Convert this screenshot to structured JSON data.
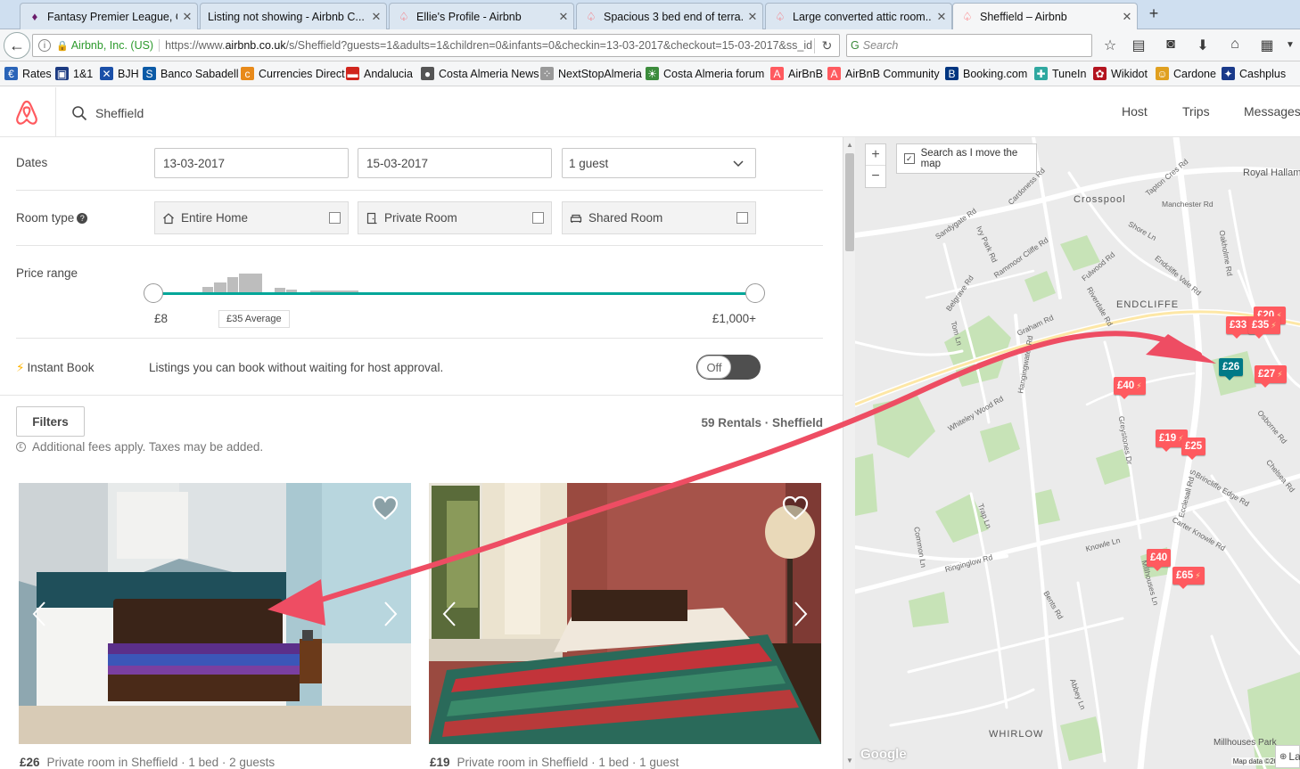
{
  "browser": {
    "tabs": [
      {
        "title": "Fantasy Premier League, O...",
        "icon": "fpl-icon"
      },
      {
        "title": "Listing not showing - Airbnb C...",
        "icon": "none"
      },
      {
        "title": "Ellie's Profile - Airbnb",
        "icon": "airbnb-icon"
      },
      {
        "title": "Spacious 3 bed end of terra...",
        "icon": "airbnb-icon"
      },
      {
        "title": "Large converted attic room...",
        "icon": "airbnb-icon"
      },
      {
        "title": "Sheffield – Airbnb",
        "icon": "airbnb-icon"
      }
    ],
    "new_tab": "+",
    "site_identity": "Airbnb, Inc. (US)",
    "url_prefix": "https://www.",
    "url_domain": "airbnb.co.uk",
    "url_rest": "/s/Sheffield?guests=1&adults=1&children=0&infants=0&checkin=13-03-2017&checkout=15-03-2017&ss_id",
    "search_placeholder": "Search",
    "bookmarks": [
      {
        "label": "Rates",
        "color": "#2a64b8",
        "glyph": "€"
      },
      {
        "label": "1&1",
        "color": "#1c3b82",
        "glyph": "▣"
      },
      {
        "label": "BJH",
        "color": "#1a4fa8",
        "glyph": "✕"
      },
      {
        "label": "Banco Sabadell",
        "color": "#0b5aa6",
        "glyph": "S"
      },
      {
        "label": "Currencies Direct",
        "color": "#e88a1a",
        "glyph": "c"
      },
      {
        "label": "Andalucia",
        "color": "#d0251d",
        "glyph": "▬"
      },
      {
        "label": "Costa Almeria News",
        "color": "#555555",
        "glyph": "●"
      },
      {
        "label": "NextStopAlmeria",
        "color": "#999999",
        "glyph": "⁘"
      },
      {
        "label": "Costa Almeria forum",
        "color": "#3c8c3c",
        "glyph": "☀"
      },
      {
        "label": "AirBnB",
        "color": "#ff5a5f",
        "glyph": "A"
      },
      {
        "label": "AirBnB Community",
        "color": "#ff5a5f",
        "glyph": "A"
      },
      {
        "label": "Booking.com",
        "color": "#003580",
        "glyph": "B"
      },
      {
        "label": "TuneIn",
        "color": "#2fa8a0",
        "glyph": "✚"
      },
      {
        "label": "Wikidot",
        "color": "#b3141f",
        "glyph": "✿"
      },
      {
        "label": "Cardone",
        "color": "#e0a020",
        "glyph": "☺"
      },
      {
        "label": "Cashplus",
        "color": "#1a3a8a",
        "glyph": "✦"
      }
    ]
  },
  "header": {
    "search_text": "Sheffield",
    "nav": [
      "Host",
      "Trips",
      "Messages"
    ],
    "brand_color": "#ff5a5f"
  },
  "filters": {
    "dates_label": "Dates",
    "checkin": "13-03-2017",
    "checkout": "15-03-2017",
    "guests": "1 guest",
    "room_type_label": "Room type",
    "help_glyph": "?",
    "room_types": [
      {
        "label": "Entire Home",
        "icon": "home-icon"
      },
      {
        "label": "Private Room",
        "icon": "door-icon"
      },
      {
        "label": "Shared Room",
        "icon": "couch-icon"
      }
    ],
    "price_label": "Price range",
    "price_min": "£8",
    "price_max": "£1,000+",
    "price_average": "£35 Average",
    "instant_book_label": "Instant Book",
    "instant_book_desc": "Listings you can book without waiting for host approval.",
    "instant_book_toggle": "Off",
    "filters_button": "Filters",
    "results_count": "59 Rentals · Sheffield",
    "fees_note": "Additional fees apply. Taxes may be added.",
    "accent_color": "#00a699"
  },
  "listings": [
    {
      "price": "£26",
      "title": "Private room in Sheffield",
      "details": "· 1 bed · 2 guests"
    },
    {
      "price": "£19",
      "title": "Private room in Sheffield",
      "details": "· 1 bed · 1 guest"
    }
  ],
  "map": {
    "search_as_move": "Search as I move the map",
    "zoom_in": "+",
    "zoom_out": "−",
    "area_labels": [
      "Crosspool",
      "ENDCLIFFE",
      "WHIRLOW",
      "Millhouses Park"
    ],
    "road_labels": [
      "Manchester Rd",
      "Sandygate Rd",
      "Graham Rd",
      "Fulwood Rd",
      "Ecclesall Rd S",
      "Knowle Ln",
      "Ringinglow Rd",
      "Whiteley Wood Rd",
      "Hangingwater Rd",
      "Brincliffe Edge Rd",
      "Carter Knowle Rd",
      "Greystones Dr",
      "Osborne Rd",
      "Chelsea Rd",
      "Ivy Park Rd",
      "Rammoor Cliffe Rd",
      "Endcliffe Vale Rd",
      "Riverdale Rd",
      "Tom Ln",
      "Belgrave Rd",
      "Common Ln",
      "Trap Ln",
      "Bents Rd",
      "Abbey Ln",
      "Shore Ln",
      "Tapton Cres Rd",
      "Cardoness Rd",
      "Royal Hallam",
      "Oakholme Rd",
      "Millhouses Ln"
    ],
    "pins": [
      {
        "price": "£20",
        "instant": true,
        "selected": false
      },
      {
        "price": "£33",
        "instant": true,
        "selected": false
      },
      {
        "price": "£35",
        "instant": true,
        "selected": false
      },
      {
        "price": "£26",
        "instant": false,
        "selected": true
      },
      {
        "price": "£27",
        "instant": true,
        "selected": false
      },
      {
        "price": "£40",
        "instant": true,
        "selected": false
      },
      {
        "price": "£19",
        "instant": true,
        "selected": false
      },
      {
        "price": "£25",
        "instant": false,
        "selected": false
      },
      {
        "price": "£40",
        "instant": false,
        "selected": false
      },
      {
        "price": "£65",
        "instant": true,
        "selected": false
      }
    ],
    "bolt": "⚡",
    "google": "Google",
    "map_data": "Map data ©2017",
    "lang": "La"
  }
}
